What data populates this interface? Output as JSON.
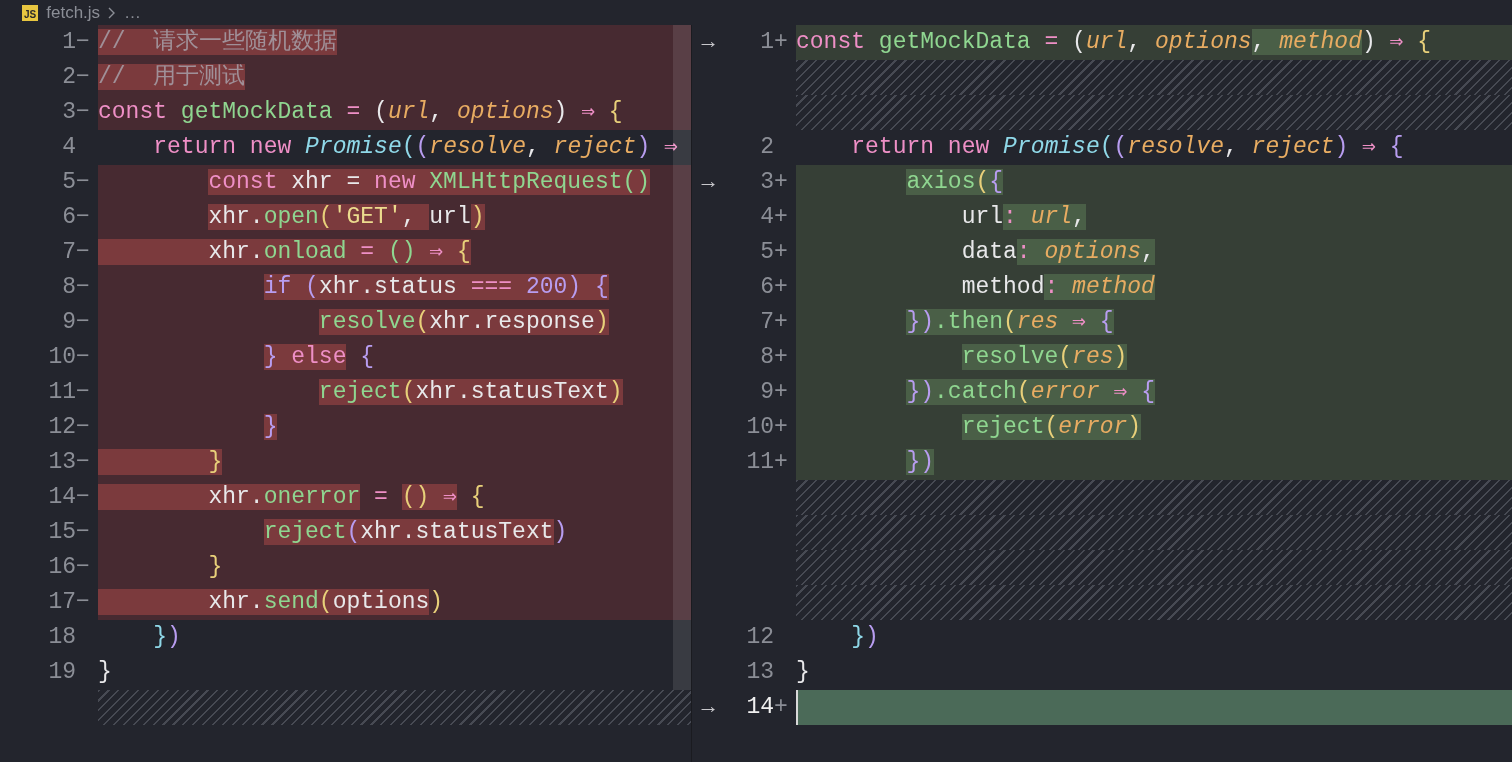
{
  "breadcrumb": {
    "file_icon_label": "JS",
    "file": "fetch.js",
    "more": "…"
  },
  "left": {
    "rows": [
      {
        "kind": "code",
        "number": "1",
        "marker": "−",
        "removed": true,
        "added": false,
        "tokens": [
          {
            "text": "//  请求一些随机数据",
            "kind": "comment",
            "highlight": true
          }
        ]
      },
      {
        "kind": "code",
        "number": "2",
        "marker": "−",
        "removed": true,
        "added": false,
        "tokens": [
          {
            "text": "//  用于测试",
            "kind": "comment",
            "highlight": true
          }
        ]
      },
      {
        "kind": "code",
        "number": "3",
        "marker": "−",
        "removed": true,
        "added": false,
        "tokens": [
          {
            "text": "const",
            "kind": "kw",
            "highlight": false
          },
          {
            "text": " getMockData",
            "kind": "fn",
            "highlight": false
          },
          {
            "text": " = ",
            "kind": "op",
            "highlight": false
          },
          {
            "text": "(",
            "kind": "plain",
            "highlight": false
          },
          {
            "text": "url",
            "kind": "param",
            "highlight": false
          },
          {
            "text": ", ",
            "kind": "plain",
            "highlight": false
          },
          {
            "text": "options",
            "kind": "param",
            "highlight": false
          },
          {
            "text": ")",
            "kind": "plain",
            "highlight": false
          },
          {
            "text": " ⇒ ",
            "kind": "op",
            "highlight": false
          },
          {
            "text": "{",
            "kind": "p1",
            "highlight": false
          }
        ]
      },
      {
        "kind": "code",
        "number": "4",
        "removed": false,
        "added": false,
        "tokens": [
          {
            "text": "    return",
            "kind": "kw"
          },
          {
            "text": " new",
            "kind": "kw"
          },
          {
            "text": " Promise",
            "kind": "cls"
          },
          {
            "text": "(",
            "kind": "p3"
          },
          {
            "text": "(",
            "kind": "p2"
          },
          {
            "text": "resolve",
            "kind": "param"
          },
          {
            "text": ", ",
            "kind": "plain"
          },
          {
            "text": "reject",
            "kind": "param"
          },
          {
            "text": ")",
            "kind": "p2"
          },
          {
            "text": " ⇒",
            "kind": "op"
          }
        ]
      },
      {
        "kind": "code",
        "number": "5",
        "marker": "−",
        "removed": true,
        "added": false,
        "tokens": [
          {
            "text": "        const",
            "kind": "kw",
            "indent_highlight": false,
            "highlight": true
          },
          {
            "text": " xhr = ",
            "kind": "plain",
            "highlight": true
          },
          {
            "text": "new",
            "kind": "kw",
            "highlight": true
          },
          {
            "text": " XMLHttpRequest",
            "kind": "fn",
            "highlight": true
          },
          {
            "text": "()",
            "kind": "fn",
            "highlight": true
          }
        ]
      },
      {
        "kind": "code",
        "number": "6",
        "marker": "−",
        "removed": true,
        "added": false,
        "tokens": [
          {
            "text": "        xhr.",
            "kind": "plain",
            "indent_highlight": false,
            "highlight": true
          },
          {
            "text": "open",
            "kind": "fn",
            "highlight": true
          },
          {
            "text": "(",
            "kind": "p1",
            "highlight": true
          },
          {
            "text": "'GET'",
            "kind": "str",
            "highlight": true
          },
          {
            "text": ", ",
            "kind": "plain",
            "highlight": true
          },
          {
            "text": "url",
            "kind": "plain",
            "highlight": false
          },
          {
            "text": ")",
            "kind": "p1",
            "highlight": true
          }
        ]
      },
      {
        "kind": "code",
        "number": "7",
        "marker": "−",
        "removed": true,
        "added": false,
        "tokens": [
          {
            "text": "        xhr.",
            "kind": "plain",
            "indent_highlight": true,
            "highlight": true
          },
          {
            "text": "onload",
            "kind": "fn",
            "highlight": true
          },
          {
            "text": " = ",
            "kind": "op",
            "highlight": true
          },
          {
            "text": "()",
            "kind": "fn",
            "highlight": true
          },
          {
            "text": " ⇒ ",
            "kind": "op",
            "highlight": true
          },
          {
            "text": "{",
            "kind": "p1",
            "highlight": true
          }
        ]
      },
      {
        "kind": "code",
        "number": "8",
        "marker": "−",
        "removed": true,
        "added": false,
        "tokens": [
          {
            "text": "            if",
            "kind": "p2",
            "indent_highlight": false,
            "highlight": true
          },
          {
            "text": " (",
            "kind": "p2",
            "highlight": true
          },
          {
            "text": "xhr.status",
            "kind": "plain",
            "highlight": true
          },
          {
            "text": " === ",
            "kind": "op",
            "highlight": true
          },
          {
            "text": "200",
            "kind": "num",
            "highlight": true
          },
          {
            "text": ")",
            "kind": "p2",
            "highlight": true
          },
          {
            "text": " {",
            "kind": "p2",
            "highlight": true
          }
        ]
      },
      {
        "kind": "code",
        "number": "9",
        "marker": "−",
        "removed": true,
        "added": false,
        "tokens": [
          {
            "text": "                resolve",
            "kind": "fn",
            "indent_highlight": false,
            "highlight": true
          },
          {
            "text": "(",
            "kind": "p1",
            "highlight": true
          },
          {
            "text": "xhr.response",
            "kind": "plain",
            "highlight": true
          },
          {
            "text": ")",
            "kind": "p1",
            "highlight": true
          }
        ]
      },
      {
        "kind": "code",
        "number": "10",
        "marker": "−",
        "removed": true,
        "added": false,
        "tokens": [
          {
            "text": "            }",
            "kind": "p2",
            "indent_highlight": false,
            "highlight": true
          },
          {
            "text": " else",
            "kind": "kw",
            "highlight": true
          },
          {
            "text": " {",
            "kind": "p2",
            "highlight": false
          }
        ]
      },
      {
        "kind": "code",
        "number": "11",
        "marker": "−",
        "removed": true,
        "added": false,
        "tokens": [
          {
            "text": "                reject",
            "kind": "fn",
            "indent_highlight": false,
            "highlight": true
          },
          {
            "text": "(",
            "kind": "p1",
            "highlight": true
          },
          {
            "text": "xhr.statusText",
            "kind": "plain",
            "highlight": true
          },
          {
            "text": ")",
            "kind": "p1",
            "highlight": true
          }
        ]
      },
      {
        "kind": "code",
        "number": "12",
        "marker": "−",
        "removed": true,
        "added": false,
        "tokens": [
          {
            "text": "            }",
            "kind": "p2",
            "indent_highlight": false,
            "highlight": true
          }
        ]
      },
      {
        "kind": "code",
        "number": "13",
        "marker": "−",
        "removed": true,
        "added": false,
        "tokens": [
          {
            "text": "        }",
            "kind": "p1",
            "indent_highlight": true,
            "highlight": true
          }
        ]
      },
      {
        "kind": "code",
        "number": "14",
        "marker": "−",
        "removed": true,
        "added": false,
        "tokens": [
          {
            "text": "        xhr.",
            "kind": "plain",
            "indent_highlight": true,
            "highlight": true
          },
          {
            "text": "onerror",
            "kind": "fn",
            "highlight": true
          },
          {
            "text": " = ",
            "kind": "op",
            "highlight": false
          },
          {
            "text": "()",
            "kind": "p1",
            "highlight": true
          },
          {
            "text": " ⇒",
            "kind": "op",
            "highlight": true
          },
          {
            "text": " {",
            "kind": "p1",
            "highlight": false
          }
        ]
      },
      {
        "kind": "code",
        "number": "15",
        "marker": "−",
        "removed": true,
        "added": false,
        "tokens": [
          {
            "text": "            reject",
            "kind": "fn",
            "indent_highlight": false,
            "highlight": true
          },
          {
            "text": "(",
            "kind": "p2",
            "highlight": true
          },
          {
            "text": "xhr.statusText",
            "kind": "plain",
            "highlight": true
          },
          {
            "text": ")",
            "kind": "p2",
            "highlight": false
          }
        ]
      },
      {
        "kind": "code",
        "number": "16",
        "marker": "−",
        "removed": true,
        "added": false,
        "tokens": [
          {
            "text": "        }",
            "kind": "p1",
            "indent_highlight": false,
            "highlight": false
          }
        ]
      },
      {
        "kind": "code",
        "number": "17",
        "marker": "−",
        "removed": true,
        "added": false,
        "tokens": [
          {
            "text": "        xhr.",
            "kind": "plain",
            "indent_highlight": true,
            "highlight": true
          },
          {
            "text": "send",
            "kind": "fn",
            "highlight": true
          },
          {
            "text": "(",
            "kind": "p1",
            "highlight": true
          },
          {
            "text": "options",
            "kind": "plain",
            "highlight": true
          },
          {
            "text": ")",
            "kind": "p1",
            "highlight": false
          }
        ]
      },
      {
        "kind": "code",
        "number": "18",
        "removed": false,
        "added": false,
        "tokens": [
          {
            "text": "    }",
            "kind": "p3"
          },
          {
            "text": ")",
            "kind": "p2"
          }
        ]
      },
      {
        "kind": "code",
        "number": "19",
        "removed": false,
        "added": false,
        "tokens": [
          {
            "text": "}",
            "kind": "plain"
          }
        ]
      },
      {
        "kind": "filler"
      }
    ]
  },
  "right": {
    "rows": [
      {
        "kind": "code",
        "arrow": "→",
        "number": "1",
        "marker": "+",
        "removed": false,
        "added": true,
        "tokens": [
          {
            "text": "const",
            "kind": "kw",
            "highlight": false
          },
          {
            "text": " getMockData",
            "kind": "fn",
            "highlight": false
          },
          {
            "text": " = ",
            "kind": "op",
            "highlight": false
          },
          {
            "text": "(",
            "kind": "plain",
            "highlight": false
          },
          {
            "text": "url",
            "kind": "param",
            "highlight": false
          },
          {
            "text": ", ",
            "kind": "plain",
            "highlight": false
          },
          {
            "text": "options",
            "kind": "param",
            "highlight": false
          },
          {
            "text": ", ",
            "kind": "plain",
            "highlight": true
          },
          {
            "text": "method",
            "kind": "param",
            "highlight": true
          },
          {
            "text": ")",
            "kind": "plain",
            "highlight": false
          },
          {
            "text": " ⇒ ",
            "kind": "op",
            "highlight": false
          },
          {
            "text": "{",
            "kind": "p1",
            "highlight": false
          }
        ]
      },
      {
        "kind": "filler"
      },
      {
        "kind": "filler"
      },
      {
        "kind": "code",
        "number": "2",
        "removed": false,
        "added": false,
        "tokens": [
          {
            "text": "    return",
            "kind": "kw"
          },
          {
            "text": " new",
            "kind": "kw"
          },
          {
            "text": " Promise",
            "kind": "cls"
          },
          {
            "text": "(",
            "kind": "p3"
          },
          {
            "text": "(",
            "kind": "p2"
          },
          {
            "text": "resolve",
            "kind": "param"
          },
          {
            "text": ", ",
            "kind": "plain"
          },
          {
            "text": "reject",
            "kind": "param"
          },
          {
            "text": ")",
            "kind": "p2"
          },
          {
            "text": " ⇒ ",
            "kind": "op"
          },
          {
            "text": "{",
            "kind": "p2"
          }
        ]
      },
      {
        "kind": "code",
        "arrow": "→",
        "number": "3",
        "marker": "+",
        "removed": false,
        "added": true,
        "tokens": [
          {
            "text": "        axios",
            "kind": "fn",
            "indent_highlight": false,
            "highlight": true
          },
          {
            "text": "(",
            "kind": "p1",
            "highlight": true
          },
          {
            "text": "{",
            "kind": "p2",
            "highlight": true
          }
        ]
      },
      {
        "kind": "code",
        "number": "4",
        "marker": "+",
        "removed": false,
        "added": true,
        "tokens": [
          {
            "text": "            url",
            "kind": "plain",
            "indent_highlight": false,
            "highlight": false
          },
          {
            "text": ": ",
            "kind": "op",
            "highlight": true
          },
          {
            "text": "url",
            "kind": "param",
            "highlight": true
          },
          {
            "text": ",",
            "kind": "plain",
            "highlight": true
          }
        ]
      },
      {
        "kind": "code",
        "number": "5",
        "marker": "+",
        "removed": false,
        "added": true,
        "tokens": [
          {
            "text": "            data",
            "kind": "plain",
            "indent_highlight": false,
            "highlight": false
          },
          {
            "text": ": ",
            "kind": "op",
            "highlight": true
          },
          {
            "text": "options",
            "kind": "param",
            "highlight": true
          },
          {
            "text": ",",
            "kind": "plain",
            "highlight": true
          }
        ]
      },
      {
        "kind": "code",
        "number": "6",
        "marker": "+",
        "removed": false,
        "added": true,
        "tokens": [
          {
            "text": "            method",
            "kind": "plain",
            "indent_highlight": false,
            "highlight": false
          },
          {
            "text": ": ",
            "kind": "op",
            "highlight": true
          },
          {
            "text": "method",
            "kind": "param",
            "highlight": true
          }
        ]
      },
      {
        "kind": "code",
        "number": "7",
        "marker": "+",
        "removed": false,
        "added": true,
        "tokens": [
          {
            "text": "        })",
            "kind": "p2",
            "indent_highlight": false,
            "highlight": true
          },
          {
            "text": ".then",
            "kind": "fn",
            "highlight": true
          },
          {
            "text": "(",
            "kind": "p1",
            "highlight": true
          },
          {
            "text": "res",
            "kind": "param",
            "highlight": true
          },
          {
            "text": " ⇒ ",
            "kind": "op",
            "highlight": true
          },
          {
            "text": "{",
            "kind": "p2",
            "highlight": true
          }
        ]
      },
      {
        "kind": "code",
        "number": "8",
        "marker": "+",
        "removed": false,
        "added": true,
        "tokens": [
          {
            "text": "            resolve",
            "kind": "fn",
            "indent_highlight": false,
            "highlight": true
          },
          {
            "text": "(",
            "kind": "p1",
            "highlight": true
          },
          {
            "text": "res",
            "kind": "param",
            "highlight": true
          },
          {
            "text": ")",
            "kind": "p1",
            "highlight": true
          }
        ]
      },
      {
        "kind": "code",
        "number": "9",
        "marker": "+",
        "removed": false,
        "added": true,
        "tokens": [
          {
            "text": "        })",
            "kind": "p2",
            "indent_highlight": false,
            "highlight": true
          },
          {
            "text": ".catch",
            "kind": "fn",
            "highlight": true
          },
          {
            "text": "(",
            "kind": "p1",
            "highlight": true
          },
          {
            "text": "error",
            "kind": "param",
            "highlight": true
          },
          {
            "text": " ⇒ ",
            "kind": "op",
            "highlight": true
          },
          {
            "text": "{",
            "kind": "p2",
            "highlight": true
          }
        ]
      },
      {
        "kind": "code",
        "number": "10",
        "marker": "+",
        "removed": false,
        "added": true,
        "tokens": [
          {
            "text": "            reject",
            "kind": "fn",
            "indent_highlight": false,
            "highlight": true
          },
          {
            "text": "(",
            "kind": "p1",
            "highlight": true
          },
          {
            "text": "error",
            "kind": "param",
            "highlight": true
          },
          {
            "text": ")",
            "kind": "p1",
            "highlight": true
          }
        ]
      },
      {
        "kind": "code",
        "number": "11",
        "marker": "+",
        "removed": false,
        "added": true,
        "tokens": [
          {
            "text": "        })",
            "kind": "p2",
            "indent_highlight": false,
            "highlight": true
          }
        ]
      },
      {
        "kind": "filler"
      },
      {
        "kind": "filler"
      },
      {
        "kind": "filler"
      },
      {
        "kind": "filler"
      },
      {
        "kind": "code",
        "number": "12",
        "removed": false,
        "added": false,
        "tokens": [
          {
            "text": "    }",
            "kind": "p3"
          },
          {
            "text": ")",
            "kind": "p2"
          }
        ]
      },
      {
        "kind": "code",
        "number": "13",
        "removed": false,
        "added": false,
        "tokens": [
          {
            "text": "}",
            "kind": "plain"
          }
        ]
      },
      {
        "kind": "code",
        "arrow": "→",
        "number": "14",
        "marker": "+",
        "removed": false,
        "added": true,
        "current": true
      }
    ]
  }
}
